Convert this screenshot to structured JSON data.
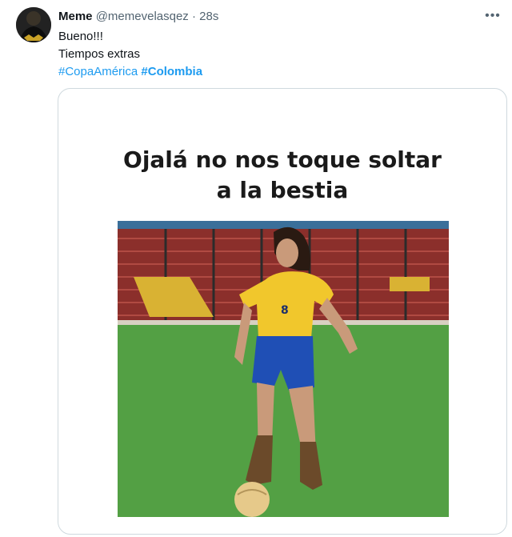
{
  "tweet": {
    "author_name": "Meme",
    "handle": "@memevelasqez",
    "separator": "·",
    "time": "28s",
    "more_label": "•••",
    "lines": [
      "Bueno!!!",
      "Tiempos extras"
    ],
    "hashtags": [
      "#CopaAmérica",
      "#Colombia"
    ]
  },
  "media": {
    "caption_line1": "Ojalá no nos toque soltar",
    "caption_line2": "a la bestia",
    "jersey_number": "8"
  },
  "colors": {
    "link": "#1d9bf0",
    "muted": "#536471",
    "text": "#0f1419",
    "border": "#cfd9de"
  }
}
